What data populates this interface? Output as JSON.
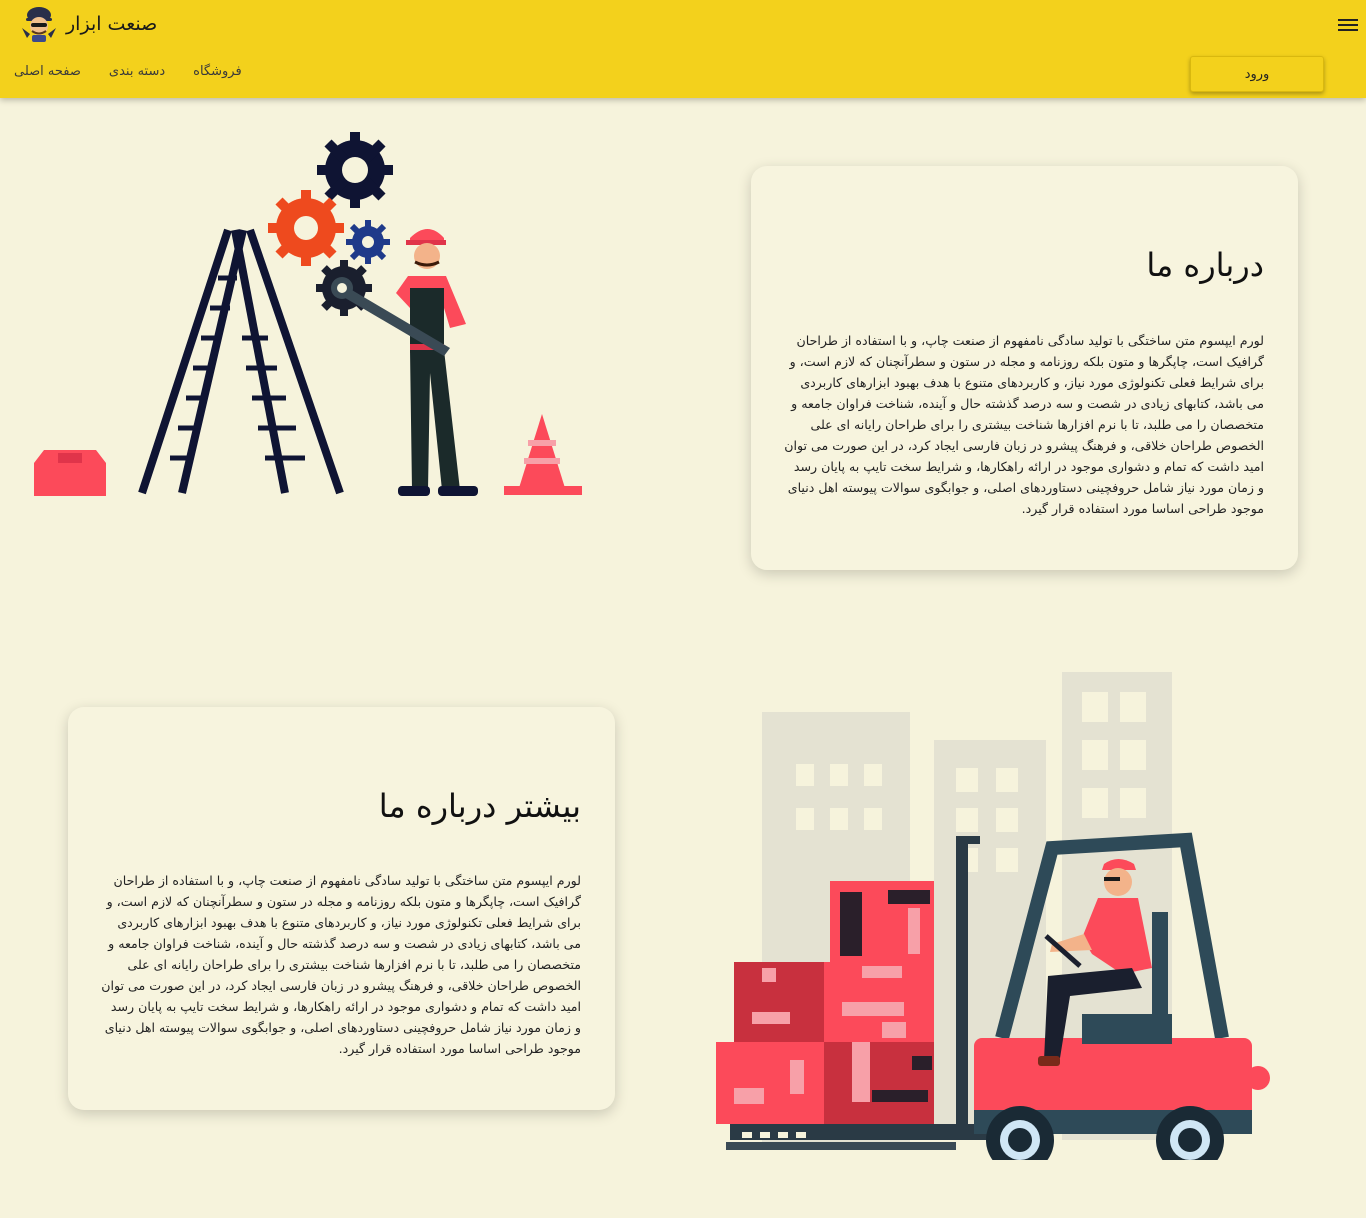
{
  "header": {
    "brand_title": "صنعت ابزار",
    "logo_icon": "worker-mascot-icon",
    "menu_icon": "hamburger-menu-icon",
    "nav": [
      "صفحه اصلی",
      "دسته بندی",
      "فروشگاه"
    ],
    "login_label": "ورود"
  },
  "sections": [
    {
      "title": "درباره ما",
      "text": "لورم ایپسوم متن ساختگی با تولید سادگی نامفهوم از صنعت چاپ، و با استفاده از طراحان گرافیک است، چاپگرها و متون بلکه روزنامه و مجله در ستون و سطرآنچنان که لازم است، و برای شرایط فعلی تکنولوژی مورد نیاز، و کاربردهای متنوع با هدف بهبود ابزارهای کاربردی می باشد، کتابهای زیادی در شصت و سه درصد گذشته حال و آینده، شناخت فراوان جامعه و متخصصان را می طلبد، تا با نرم افزارها شناخت بیشتری را برای طراحان رایانه ای علی الخصوص طراحان خلاقی، و فرهنگ پیشرو در زبان فارسی ایجاد کرد، در این صورت می توان امید داشت که تمام و دشواری موجود در ارائه راهکارها، و شرایط سخت تایپ به پایان رسد و زمان مورد نیاز شامل حروفچینی دستاوردهای اصلی، و جوابگوی سوالات پیوسته اهل دنیای موجود طراحی اساسا مورد استفاده قرار گیرد.",
      "illustration": "worker-ladder-gears-illustration"
    },
    {
      "title": "بیشتر درباره ما",
      "text": "لورم ایپسوم متن ساختگی با تولید سادگی نامفهوم از صنعت چاپ، و با استفاده از طراحان گرافیک است، چاپگرها و متون بلکه روزنامه و مجله در ستون و سطرآنچنان که لازم است، و برای شرایط فعلی تکنولوژی مورد نیاز، و کاربردهای متنوع با هدف بهبود ابزارهای کاربردی می باشد، کتابهای زیادی در شصت و سه درصد گذشته حال و آینده، شناخت فراوان جامعه و متخصصان را می طلبد، تا با نرم افزارها شناخت بیشتری را برای طراحان رایانه ای علی الخصوص طراحان خلاقی، و فرهنگ پیشرو در زبان فارسی ایجاد کرد، در این صورت می توان امید داشت که تمام و دشواری موجود در ارائه راهکارها، و شرایط سخت تایپ به پایان رسد و زمان مورد نیاز شامل حروفچینی دستاوردهای اصلی، و جوابگوی سوالات پیوسته اهل دنیای موجود طراحی اساسا مورد استفاده قرار گیرد.",
      "illustration": "forklift-boxes-illustration"
    }
  ],
  "colors": {
    "header_bg": "#f3d11c",
    "page_bg": "#f6f3dc",
    "accent_red": "#fc4a5a",
    "dark_navy": "#0f1433"
  }
}
